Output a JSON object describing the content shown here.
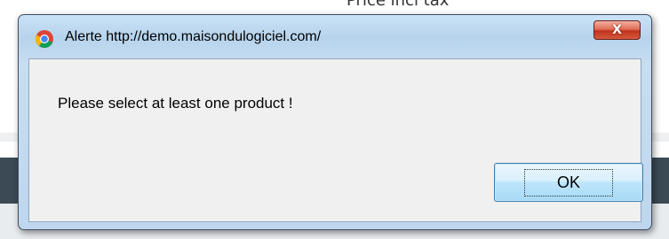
{
  "background": {
    "partial_text": "Price incl tax"
  },
  "dialog": {
    "title": "Alerte http://demo.maisondulogiciel.com/",
    "close_label": "X",
    "message": "Please select at least one product !",
    "ok_label": "OK",
    "icon": "chrome-icon"
  },
  "colors": {
    "frame": "#bed6ee",
    "close_button": "#c2321d",
    "client_area": "#f0f0f0",
    "ok_button": "#bee6fd"
  }
}
